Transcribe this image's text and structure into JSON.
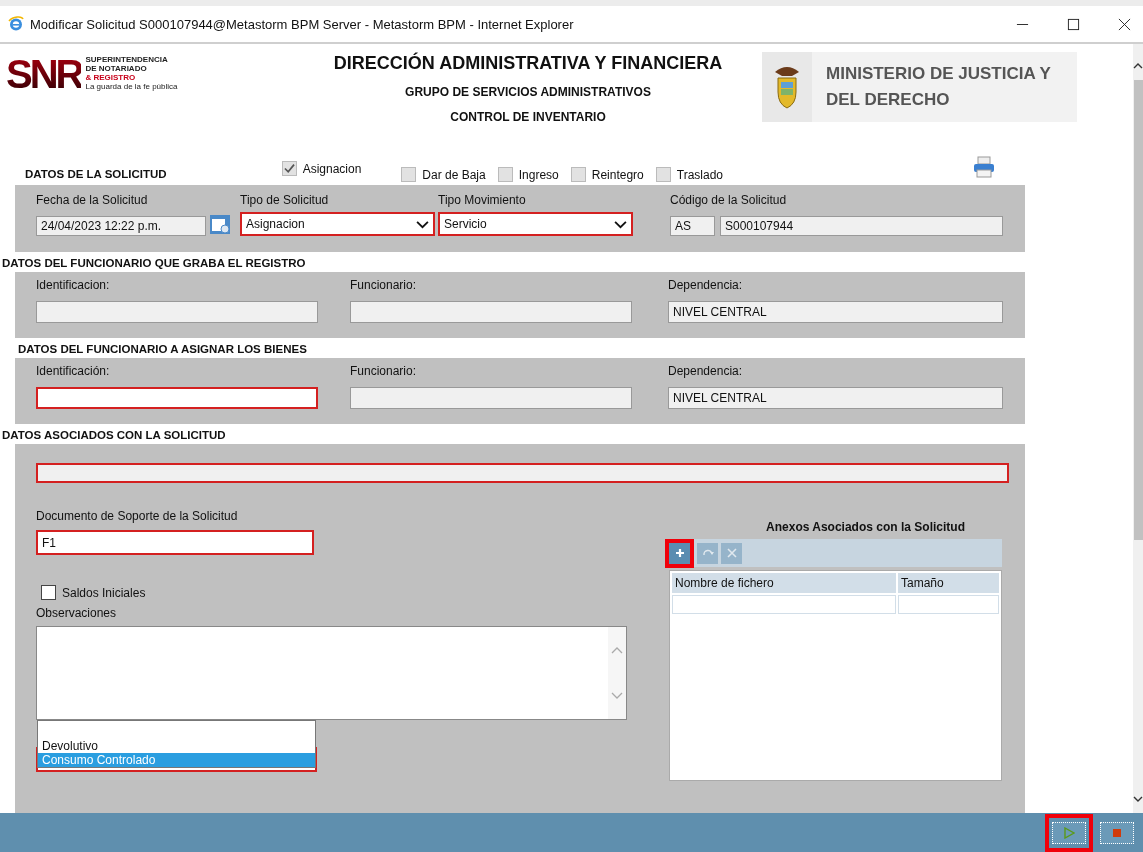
{
  "window": {
    "title": "Modificar Solicitud S000107944@Metastorm BPM Server - Metastorm BPM - Internet Explorer"
  },
  "header": {
    "logo": {
      "mark": "SNR",
      "lines": [
        {
          "text": "SUPERINTENDENCIA",
          "emphasis": false
        },
        {
          "text": "DE NOTARIADO",
          "emphasis": false
        },
        {
          "text": "& REGISTRO",
          "emphasis": true
        },
        {
          "text": "La guarda de la fe pública",
          "emphasis": false
        }
      ]
    },
    "titles": [
      "DIRECCIÓN ADMINISTRATIVA Y FINANCIERA",
      "GRUPO DE SERVICIOS ADMINISTRATIVOS",
      "CONTROL DE INVENTARIO"
    ],
    "ministry": "MINISTERIO DE JUSTICIA Y DEL DERECHO"
  },
  "solicitud": {
    "title": "DATOS DE LA SOLICITUD",
    "types": [
      {
        "label": "Asignacion",
        "checked": true
      },
      {
        "label": "Dar de Baja",
        "checked": false
      },
      {
        "label": "Ingreso",
        "checked": false
      },
      {
        "label": "Reintegro",
        "checked": false
      },
      {
        "label": "Traslado",
        "checked": false
      }
    ],
    "fields": [
      {
        "kind": "date",
        "label": "Fecha de la Solicitud",
        "value": "24/04/2023 12:22 p.m.",
        "required": false
      },
      {
        "kind": "select",
        "label": "Tipo de Solicitud",
        "value": "Asignacion",
        "required": true
      },
      {
        "kind": "select",
        "label": "Tipo Movimiento",
        "value": "Servicio",
        "required": true
      },
      {
        "kind": "code",
        "label": "Código de la Solicitud",
        "prefix": "AS",
        "value": "S000107944",
        "required": false
      }
    ]
  },
  "sections": [
    {
      "title": "DATOS DEL FUNCIONARIO QUE GRABA EL REGISTRO",
      "fields": [
        {
          "label": "Identificacion:",
          "readonly": true,
          "required": false
        },
        {
          "label": "Funcionario:",
          "readonly": true,
          "required": false
        },
        {
          "label": "Dependencia:",
          "value": "NIVEL CENTRAL",
          "readonly": true,
          "required": false
        }
      ]
    },
    {
      "title": "DATOS DEL FUNCIONARIO A ASIGNAR LOS BIENES",
      "fields": [
        {
          "label": "Identificación:",
          "readonly": false,
          "required": true
        },
        {
          "label": "Funcionario:",
          "readonly": true,
          "required": false
        },
        {
          "label": "Dependencia:",
          "value": "NIVEL CENTRAL",
          "readonly": true,
          "required": false
        }
      ]
    }
  ],
  "asociados": {
    "title": "DATOS ASOCIADOS CON LA SOLICITUD",
    "banner": {
      "required": true
    },
    "documento": {
      "label": "Documento de Soporte de la Solicitud",
      "value": "F1",
      "required": true
    },
    "saldos": {
      "label": "Saldos Iniciales",
      "checked": false
    },
    "observaciones": {
      "label": "Observaciones"
    },
    "dropdown": {
      "required": true,
      "options": [
        {
          "label": "Devolutivo",
          "selected": false
        },
        {
          "label": "Consumo Controlado",
          "selected": true
        }
      ]
    },
    "anexos": {
      "title": "Anexos Asociados con la Solicitud",
      "tools": [
        {
          "kind": "add",
          "disabled": false,
          "highlighted": true
        },
        {
          "kind": "refresh",
          "disabled": true,
          "highlighted": false
        },
        {
          "kind": "delete",
          "disabled": true,
          "highlighted": false
        }
      ],
      "columns": [
        "Nombre de fichero",
        "Tamaño"
      ]
    }
  },
  "footer": {
    "buttons": [
      {
        "kind": "play",
        "highlighted": true
      },
      {
        "kind": "stop",
        "highlighted": false
      }
    ]
  }
}
